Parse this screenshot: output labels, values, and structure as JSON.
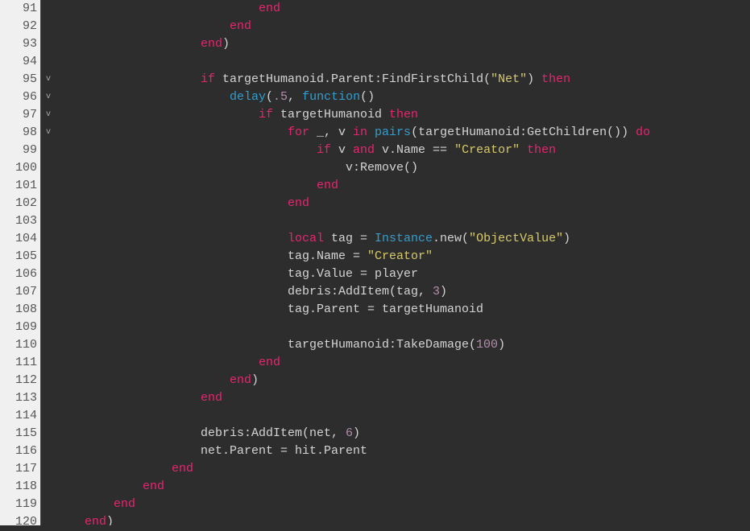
{
  "editor": {
    "first_line_number": 91,
    "fold_markers": {
      "95": "v",
      "96": "v",
      "97": "v",
      "98": "v"
    },
    "lines": [
      {
        "n": 91,
        "indent": 28,
        "tokens": [
          {
            "t": "end",
            "c": "kw"
          }
        ]
      },
      {
        "n": 92,
        "indent": 24,
        "tokens": [
          {
            "t": "end",
            "c": "kw"
          }
        ]
      },
      {
        "n": 93,
        "indent": 20,
        "tokens": [
          {
            "t": "end",
            "c": "kw"
          },
          {
            "t": ")",
            "c": "op"
          }
        ]
      },
      {
        "n": 94,
        "indent": 0,
        "tokens": []
      },
      {
        "n": 95,
        "indent": 20,
        "tokens": [
          {
            "t": "if ",
            "c": "kw"
          },
          {
            "t": "targetHumanoid.Parent:FindFirstChild(",
            "c": "id"
          },
          {
            "t": "\"Net\"",
            "c": "str"
          },
          {
            "t": ") ",
            "c": "id"
          },
          {
            "t": "then",
            "c": "kw"
          }
        ]
      },
      {
        "n": 96,
        "indent": 24,
        "tokens": [
          {
            "t": "delay",
            "c": "fn"
          },
          {
            "t": "(",
            "c": "op"
          },
          {
            "t": ".5",
            "c": "num"
          },
          {
            "t": ", ",
            "c": "op"
          },
          {
            "t": "function",
            "c": "fn"
          },
          {
            "t": "()",
            "c": "op"
          }
        ]
      },
      {
        "n": 97,
        "indent": 28,
        "tokens": [
          {
            "t": "if ",
            "c": "kw"
          },
          {
            "t": "targetHumanoid ",
            "c": "id"
          },
          {
            "t": "then",
            "c": "kw"
          }
        ]
      },
      {
        "n": 98,
        "indent": 32,
        "tokens": [
          {
            "t": "for ",
            "c": "kw"
          },
          {
            "t": "_, v ",
            "c": "id"
          },
          {
            "t": "in ",
            "c": "kw"
          },
          {
            "t": "pairs",
            "c": "fn"
          },
          {
            "t": "(targetHumanoid:GetChildren()) ",
            "c": "id"
          },
          {
            "t": "do",
            "c": "kw"
          }
        ]
      },
      {
        "n": 99,
        "indent": 36,
        "tokens": [
          {
            "t": "if ",
            "c": "kw"
          },
          {
            "t": "v ",
            "c": "id"
          },
          {
            "t": "and ",
            "c": "kw"
          },
          {
            "t": "v.Name == ",
            "c": "id"
          },
          {
            "t": "\"Creator\"",
            "c": "str"
          },
          {
            "t": " ",
            "c": "id"
          },
          {
            "t": "then",
            "c": "kw"
          }
        ]
      },
      {
        "n": 100,
        "indent": 40,
        "tokens": [
          {
            "t": "v:Remove()",
            "c": "id"
          }
        ]
      },
      {
        "n": 101,
        "indent": 36,
        "tokens": [
          {
            "t": "end",
            "c": "kw"
          }
        ]
      },
      {
        "n": 102,
        "indent": 32,
        "tokens": [
          {
            "t": "end",
            "c": "kw"
          }
        ]
      },
      {
        "n": 103,
        "indent": 0,
        "tokens": []
      },
      {
        "n": 104,
        "indent": 32,
        "tokens": [
          {
            "t": "local ",
            "c": "kw"
          },
          {
            "t": "tag = ",
            "c": "id"
          },
          {
            "t": "Instance",
            "c": "fn"
          },
          {
            "t": ".new(",
            "c": "id"
          },
          {
            "t": "\"ObjectValue\"",
            "c": "str"
          },
          {
            "t": ")",
            "c": "id"
          }
        ]
      },
      {
        "n": 105,
        "indent": 32,
        "tokens": [
          {
            "t": "tag.Name = ",
            "c": "id"
          },
          {
            "t": "\"Creator\"",
            "c": "str"
          }
        ]
      },
      {
        "n": 106,
        "indent": 32,
        "tokens": [
          {
            "t": "tag.Value = player",
            "c": "id"
          }
        ]
      },
      {
        "n": 107,
        "indent": 32,
        "tokens": [
          {
            "t": "debris:AddItem(tag, ",
            "c": "id"
          },
          {
            "t": "3",
            "c": "num"
          },
          {
            "t": ")",
            "c": "id"
          }
        ]
      },
      {
        "n": 108,
        "indent": 32,
        "tokens": [
          {
            "t": "tag.Parent = targetHumanoid",
            "c": "id"
          }
        ]
      },
      {
        "n": 109,
        "indent": 0,
        "tokens": []
      },
      {
        "n": 110,
        "indent": 32,
        "tokens": [
          {
            "t": "targetHumanoid:TakeDamage(",
            "c": "id"
          },
          {
            "t": "100",
            "c": "num"
          },
          {
            "t": ")",
            "c": "id"
          }
        ]
      },
      {
        "n": 111,
        "indent": 28,
        "tokens": [
          {
            "t": "end",
            "c": "kw"
          }
        ]
      },
      {
        "n": 112,
        "indent": 24,
        "tokens": [
          {
            "t": "end",
            "c": "kw"
          },
          {
            "t": ")",
            "c": "op"
          }
        ]
      },
      {
        "n": 113,
        "indent": 20,
        "tokens": [
          {
            "t": "end",
            "c": "kw"
          }
        ]
      },
      {
        "n": 114,
        "indent": 0,
        "tokens": []
      },
      {
        "n": 115,
        "indent": 20,
        "tokens": [
          {
            "t": "debris:AddItem(net, ",
            "c": "id"
          },
          {
            "t": "6",
            "c": "num"
          },
          {
            "t": ")",
            "c": "id"
          }
        ]
      },
      {
        "n": 116,
        "indent": 20,
        "tokens": [
          {
            "t": "net.Parent = hit.Parent",
            "c": "id"
          }
        ]
      },
      {
        "n": 117,
        "indent": 16,
        "tokens": [
          {
            "t": "end",
            "c": "kw"
          }
        ]
      },
      {
        "n": 118,
        "indent": 12,
        "tokens": [
          {
            "t": "end",
            "c": "kw"
          }
        ]
      },
      {
        "n": 119,
        "indent": 8,
        "tokens": [
          {
            "t": "end",
            "c": "kw"
          }
        ]
      },
      {
        "n": 120,
        "indent": 4,
        "tokens": [
          {
            "t": "end",
            "c": "kw"
          },
          {
            "t": ")",
            "c": "op"
          }
        ]
      }
    ]
  }
}
